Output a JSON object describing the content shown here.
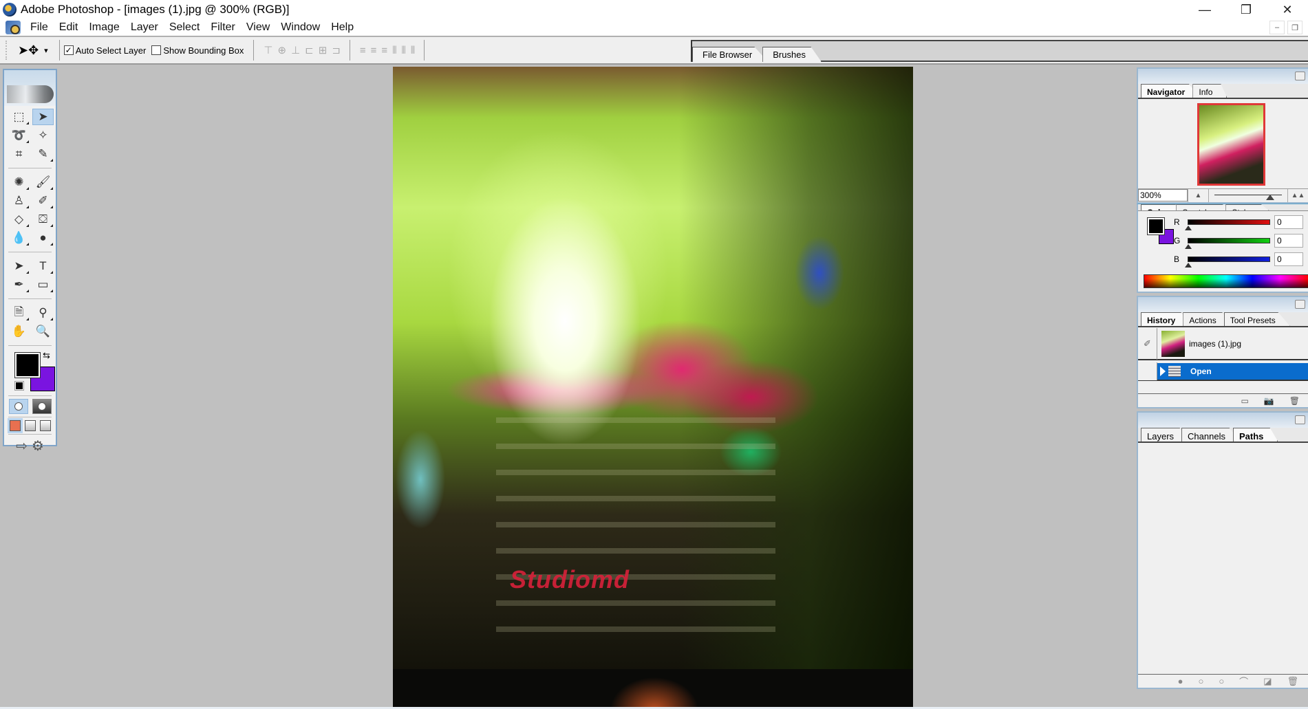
{
  "titlebar": {
    "title": "Adobe Photoshop - [images (1).jpg @ 300% (RGB)]",
    "buttons": [
      "minimize",
      "restore",
      "close"
    ],
    "glyphs": {
      "minimize": "—",
      "restore": "❐",
      "close": "✕"
    }
  },
  "menubar": {
    "items": [
      "File",
      "Edit",
      "Image",
      "Layer",
      "Select",
      "Filter",
      "View",
      "Window",
      "Help"
    ],
    "mdi_glyphs": {
      "minimize": "–",
      "restore": "❐"
    }
  },
  "options": {
    "tool_glyph": "➤✥",
    "dropdown_glyph": "▾",
    "auto_select_label": "Auto Select Layer",
    "auto_select_checked": true,
    "show_bbox_label": "Show Bounding Box",
    "show_bbox_checked": false,
    "align_glyphs": [
      "⊤",
      "⊕",
      "⊥",
      "⊏",
      "⊞",
      "⊐"
    ],
    "distribute_glyphs": [
      "≡",
      "≡",
      "≡",
      "⫴",
      "⫴",
      "⫴"
    ]
  },
  "palette_well": {
    "tabs": [
      "File Browser",
      "Brushes"
    ]
  },
  "toolbox": {
    "tools": [
      {
        "name": "marquee",
        "glyph": "⬚",
        "selected": false
      },
      {
        "name": "move",
        "glyph": "➤",
        "selected": true
      },
      {
        "name": "lasso",
        "glyph": "➰",
        "selected": false
      },
      {
        "name": "magic-wand",
        "glyph": "✧",
        "selected": false
      },
      {
        "name": "crop",
        "glyph": "⌗",
        "selected": false
      },
      {
        "name": "slice",
        "glyph": "✎",
        "selected": false
      },
      {
        "name": "healing-brush",
        "glyph": "✺",
        "selected": false
      },
      {
        "name": "brush",
        "glyph": "🖌",
        "selected": false
      },
      {
        "name": "clone-stamp",
        "glyph": "♙",
        "selected": false
      },
      {
        "name": "history-brush",
        "glyph": "✐",
        "selected": false
      },
      {
        "name": "eraser",
        "glyph": "◇",
        "selected": false
      },
      {
        "name": "paint-bucket",
        "glyph": "⛋",
        "selected": false
      },
      {
        "name": "blur",
        "glyph": "💧",
        "selected": false
      },
      {
        "name": "dodge",
        "glyph": "●",
        "selected": false
      },
      {
        "name": "path-selection",
        "glyph": "➤",
        "selected": false
      },
      {
        "name": "type",
        "glyph": "T",
        "selected": false
      },
      {
        "name": "pen",
        "glyph": "✒",
        "selected": false
      },
      {
        "name": "shape",
        "glyph": "▭",
        "selected": false
      },
      {
        "name": "notes",
        "glyph": "🗎",
        "selected": false
      },
      {
        "name": "eyedropper",
        "glyph": "⚲",
        "selected": false
      },
      {
        "name": "hand",
        "glyph": "✋",
        "selected": false
      },
      {
        "name": "zoom",
        "glyph": "🔍",
        "selected": false
      }
    ],
    "foreground_color": "#000000",
    "background_color": "#7a14e0",
    "swap_glyph": "⇆"
  },
  "canvas": {
    "watermark": "Studiomd"
  },
  "navigator": {
    "tabs": [
      "Navigator",
      "Info"
    ],
    "active_tab": "Navigator",
    "zoom_value": "300%",
    "zoom_slider_fraction": 0.78,
    "zoom_out_glyph": "▲",
    "zoom_in_glyph": "▲▲"
  },
  "color_panel": {
    "tabs": [
      "Color",
      "Swatches",
      "Styles"
    ],
    "channels": [
      {
        "label": "R",
        "value": "0",
        "color": "#e01010"
      },
      {
        "label": "G",
        "value": "0",
        "color": "#10d010"
      },
      {
        "label": "B",
        "value": "0",
        "color": "#1020e0"
      }
    ]
  },
  "history": {
    "tabs": [
      "History",
      "Actions",
      "Tool Presets"
    ],
    "active_tab": "History",
    "snapshot_label": "images (1).jpg",
    "steps": [
      {
        "label": "Open",
        "selected": true
      }
    ],
    "footer_glyphs": [
      "▭",
      "📷",
      "🗑"
    ]
  },
  "paths": {
    "tabs": [
      "Layers",
      "Channels",
      "Paths"
    ],
    "active_tab": "Paths",
    "footer_glyphs": [
      "●",
      "○",
      "○",
      "⌒",
      "◪",
      "🗑"
    ]
  }
}
